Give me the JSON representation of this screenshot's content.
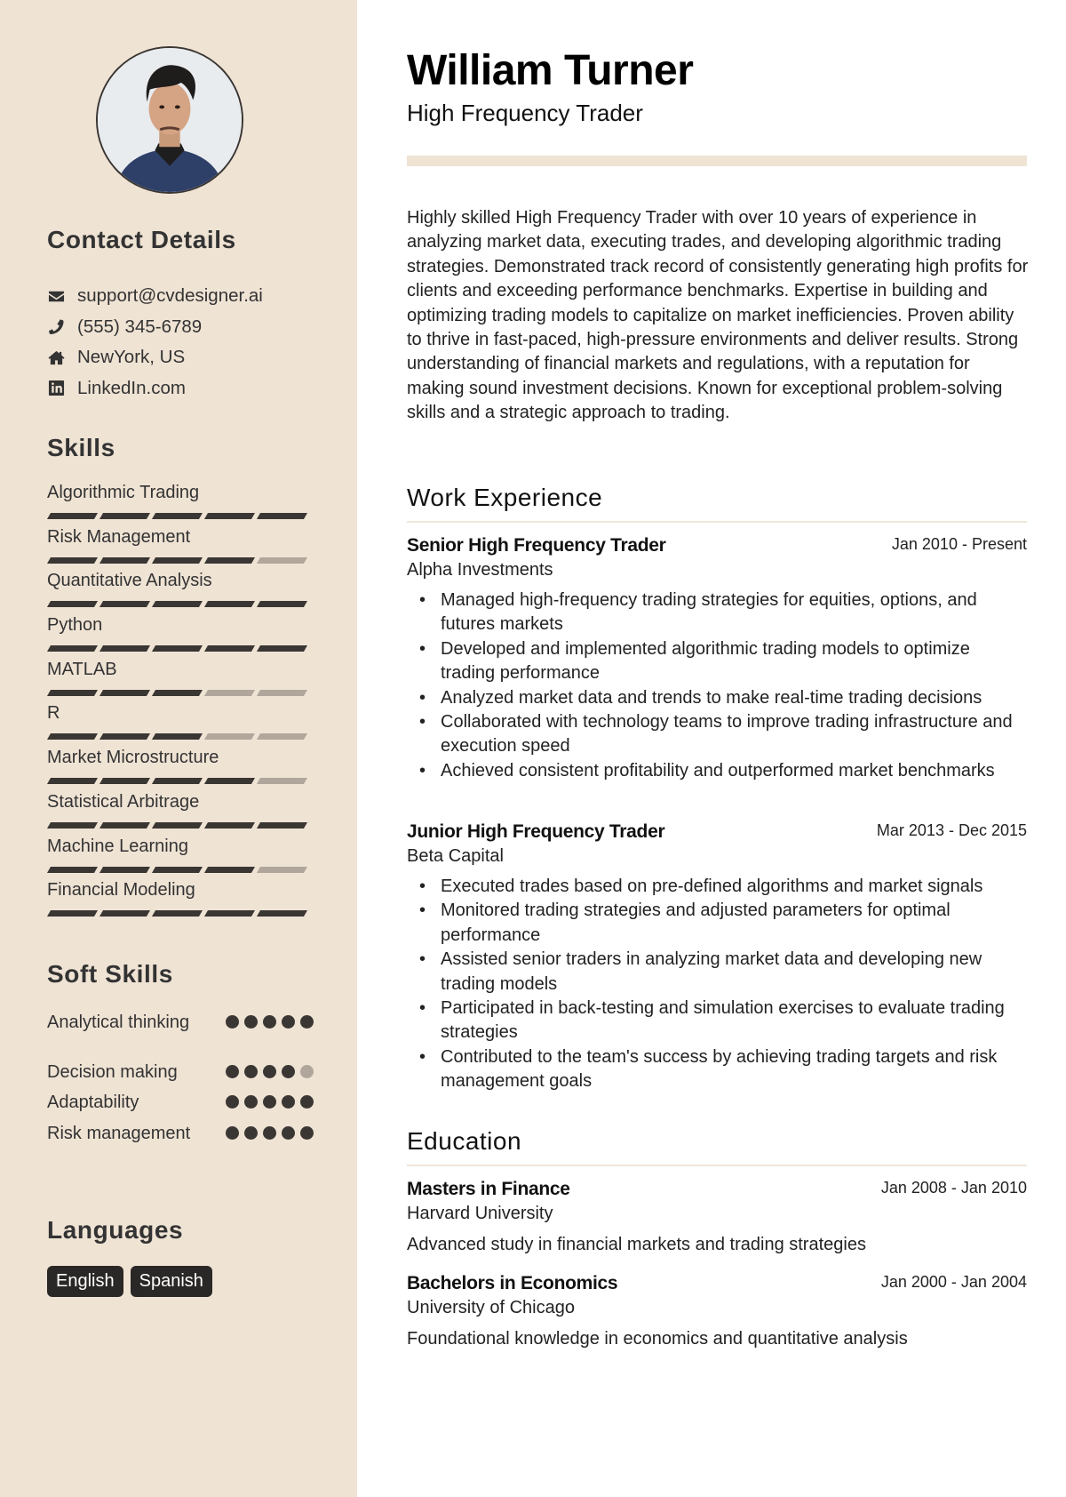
{
  "profile": {
    "name": "William Turner",
    "title": "High Frequency Trader",
    "accent_color": "#efe3d4",
    "photo_alt": "Profile photo"
  },
  "contact": {
    "heading": "Contact Details",
    "items": [
      {
        "icon": "envelope-icon",
        "text": "support@cvdesigner.ai"
      },
      {
        "icon": "phone-icon",
        "text": "(555) 345-6789"
      },
      {
        "icon": "home-icon",
        "text": "NewYork, US"
      },
      {
        "icon": "linkedin-icon",
        "text": "LinkedIn.com"
      }
    ]
  },
  "skills": {
    "heading": "Skills",
    "max": 5,
    "items": [
      {
        "name": "Algorithmic Trading",
        "level": 5
      },
      {
        "name": "Risk Management",
        "level": 4
      },
      {
        "name": "Quantitative Analysis",
        "level": 5
      },
      {
        "name": "Python",
        "level": 5
      },
      {
        "name": "MATLAB",
        "level": 3
      },
      {
        "name": "R",
        "level": 3
      },
      {
        "name": "Market Microstructure",
        "level": 4
      },
      {
        "name": "Statistical Arbitrage",
        "level": 5
      },
      {
        "name": "Machine Learning",
        "level": 4
      },
      {
        "name": "Financial Modeling",
        "level": 5
      }
    ]
  },
  "soft_skills": {
    "heading": "Soft Skills",
    "max": 5,
    "items": [
      {
        "name": "Analytical thinking",
        "level": 5
      },
      {
        "name": "Decision making",
        "level": 4
      },
      {
        "name": "Adaptability",
        "level": 5
      },
      {
        "name": "Risk management",
        "level": 5
      }
    ]
  },
  "languages": {
    "heading": "Languages",
    "items": [
      "English",
      "Spanish"
    ]
  },
  "summary": "Highly skilled High Frequency Trader with over 10 years of experience in analyzing market data, executing trades, and developing algorithmic trading strategies. Demonstrated track record of consistently generating high profits for clients and exceeding performance benchmarks. Expertise in building and optimizing trading models to capitalize on market inefficiencies. Proven ability to thrive in fast-paced, high-pressure environments and deliver results. Strong understanding of financial markets and regulations, with a reputation for making sound investment decisions. Known for exceptional problem-solving skills and a strategic approach to trading.",
  "work": {
    "heading": "Work Experience",
    "entries": [
      {
        "role": "Senior High Frequency Trader",
        "company": "Alpha Investments",
        "dates": "Jan 2010 - Present",
        "bullets": [
          "Managed high-frequency trading strategies for equities, options, and futures markets",
          "Developed and implemented algorithmic trading models to optimize trading performance",
          "Analyzed market data and trends to make real-time trading decisions",
          "Collaborated with technology teams to improve trading infrastructure and execution speed",
          "Achieved consistent profitability and outperformed market benchmarks"
        ]
      },
      {
        "role": "Junior High Frequency Trader",
        "company": "Beta Capital",
        "dates": "Mar 2013 - Dec 2015",
        "bullets": [
          "Executed trades based on pre-defined algorithms and market signals",
          "Monitored trading strategies and adjusted parameters for optimal performance",
          "Assisted senior traders in analyzing market data and developing new trading models",
          "Participated in back-testing and simulation exercises to evaluate trading strategies",
          "Contributed to the team's success by achieving trading targets and risk management goals"
        ]
      }
    ]
  },
  "education": {
    "heading": "Education",
    "entries": [
      {
        "degree": "Masters in Finance",
        "school": "Harvard University",
        "dates": "Jan 2008 - Jan 2010",
        "description": "Advanced study in financial markets and trading strategies"
      },
      {
        "degree": "Bachelors in Economics",
        "school": "University of Chicago",
        "dates": "Jan 2000 - Jan 2004",
        "description": "Foundational knowledge in economics and quantitative analysis"
      }
    ]
  }
}
